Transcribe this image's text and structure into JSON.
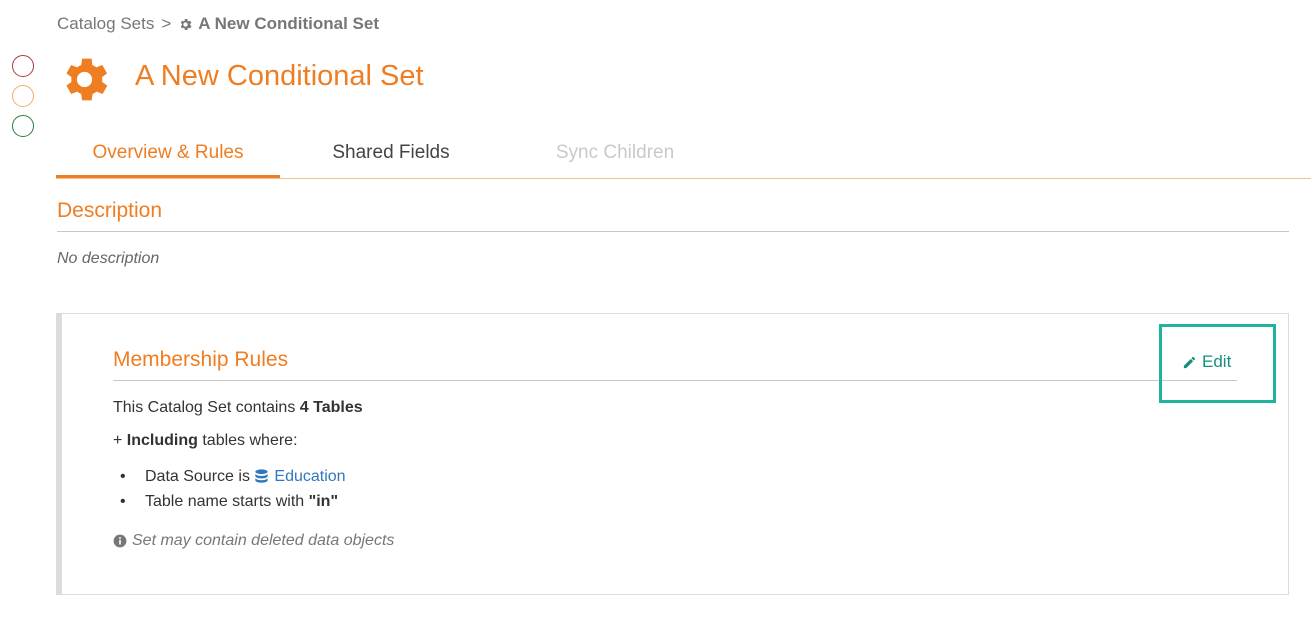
{
  "breadcrumb": {
    "parent": "Catalog Sets",
    "separator": ">",
    "current": "A New Conditional Set",
    "current_icon": "gear-icon"
  },
  "status_indicators": [
    {
      "name": "red",
      "color": "#a93a3a"
    },
    {
      "name": "orange",
      "color": "#f0b06a"
    },
    {
      "name": "green",
      "color": "#2f7d3a"
    }
  ],
  "header": {
    "title": "A New Conditional Set",
    "icon": "gear-icon",
    "accent_color": "#ef7d22"
  },
  "tabs": [
    {
      "label": "Overview & Rules",
      "state": "active"
    },
    {
      "label": "Shared Fields",
      "state": "normal"
    },
    {
      "label": "Sync Children",
      "state": "disabled"
    }
  ],
  "description": {
    "heading": "Description",
    "text": "No description"
  },
  "membership": {
    "heading": "Membership Rules",
    "edit_label": "Edit",
    "edit_icon": "pencil-icon",
    "summary_prefix": "This Catalog Set contains",
    "summary_count": "4 Tables",
    "including_prefix": "+",
    "including_bold": "Including",
    "including_suffix": "tables where:",
    "rules": [
      {
        "prefix": "Data Source is",
        "link": "Education",
        "icon": "database-icon"
      },
      {
        "prefix": "Table name starts with",
        "value": "\"in\""
      }
    ],
    "note": "Set may contain deleted data objects",
    "note_icon": "info-circle-icon"
  },
  "colors": {
    "accent": "#ef7d22",
    "edit_teal": "#15907b",
    "highlight": "#20b29a",
    "link_blue": "#2f78c0"
  }
}
